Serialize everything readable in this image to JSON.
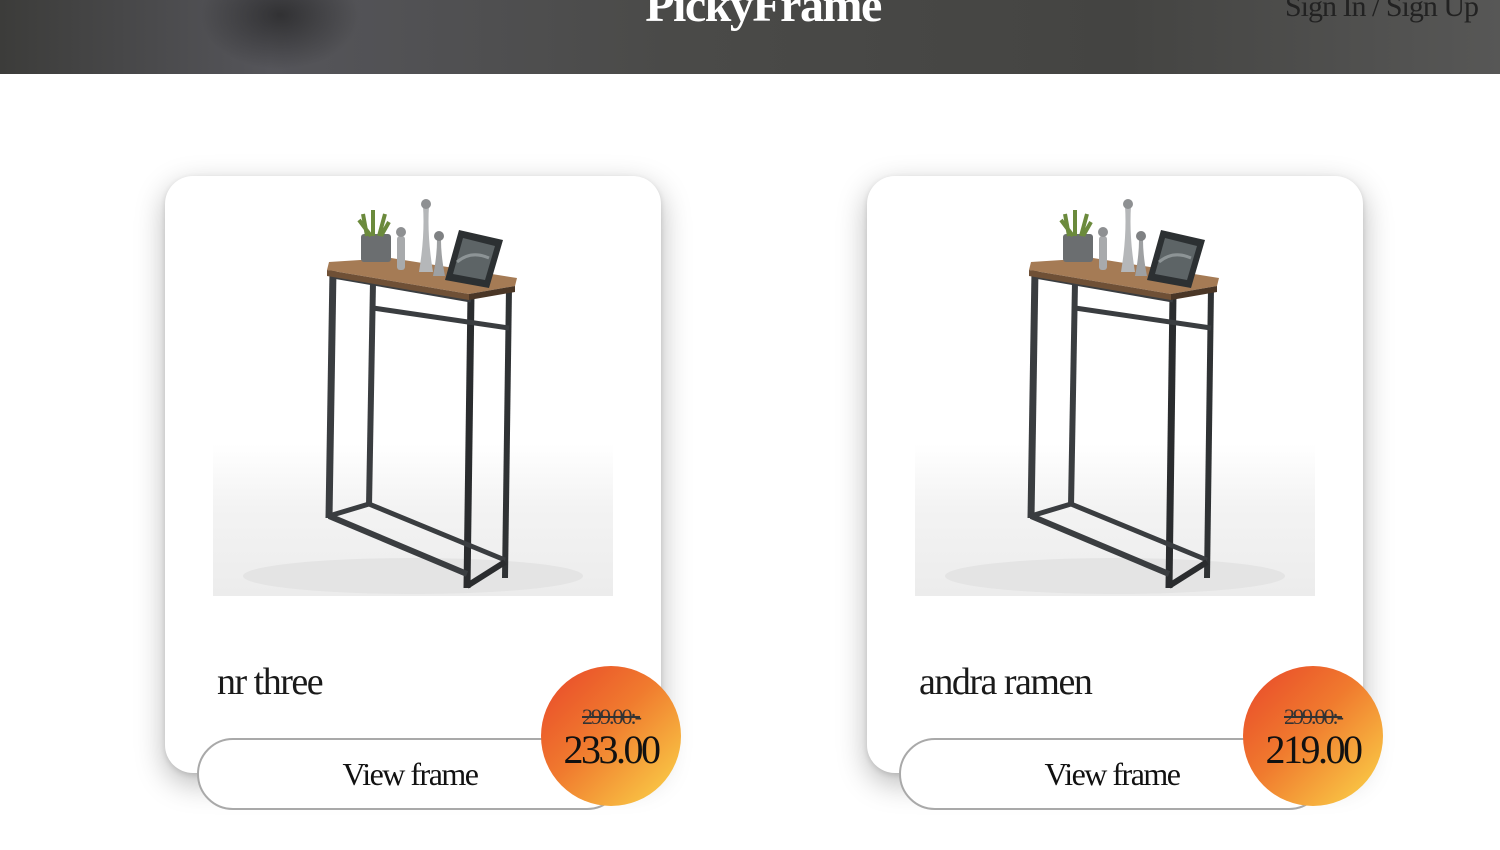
{
  "header": {
    "logo": "PickyFrame",
    "sign_in": "Sign In",
    "separator": " / ",
    "sign_up": "Sign Up"
  },
  "products": [
    {
      "title": "nr three",
      "old_price": "299.00:-",
      "new_price": "233.00",
      "button_label": "View frame"
    },
    {
      "title": "andra ramen",
      "old_price": "299.00:-",
      "new_price": "219.00",
      "button_label": "View frame"
    }
  ],
  "colors": {
    "header_bg": "#4a4a48",
    "badge_start": "#e8462a",
    "badge_end": "#fbd84a"
  }
}
